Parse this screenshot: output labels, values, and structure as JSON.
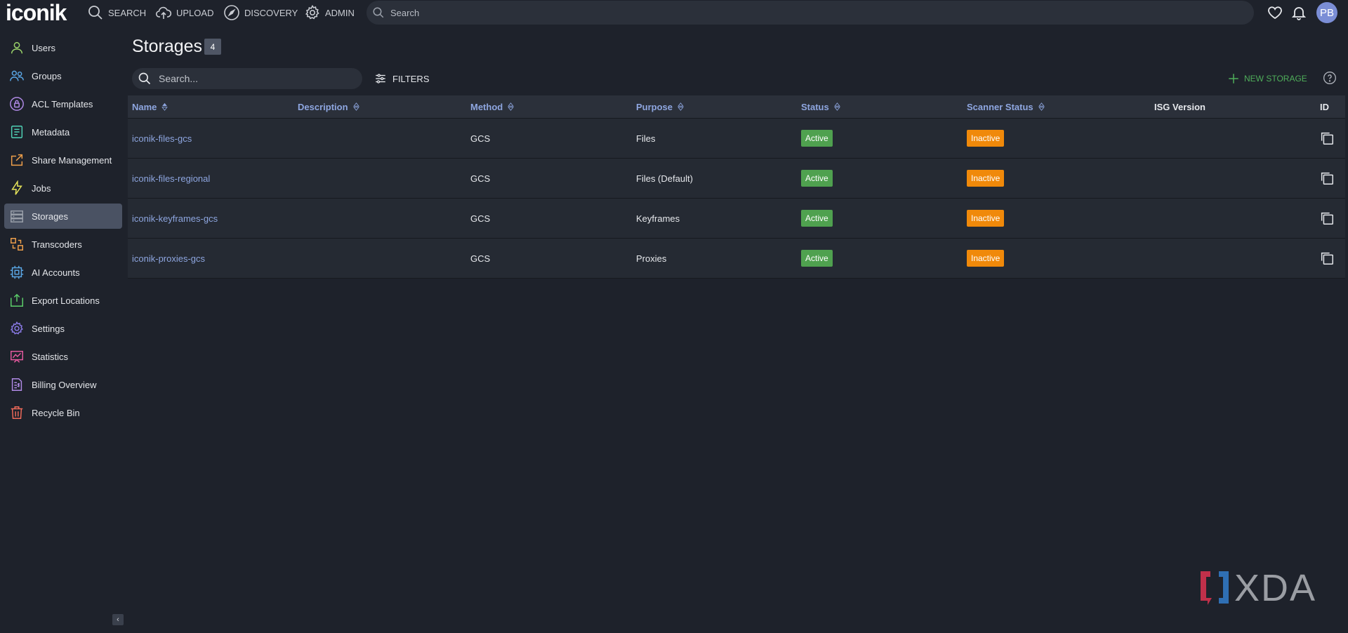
{
  "app": {
    "logo": "iconik"
  },
  "topnav": [
    {
      "label": "SEARCH",
      "icon": "search-icon"
    },
    {
      "label": "UPLOAD",
      "icon": "cloud-upload-icon"
    },
    {
      "label": "DISCOVERY",
      "icon": "compass-icon"
    },
    {
      "label": "ADMIN",
      "icon": "gear-icon"
    }
  ],
  "global_search": {
    "placeholder": "Search"
  },
  "user": {
    "initials": "PB"
  },
  "sidebar": {
    "items": [
      {
        "label": "Users",
        "icon": "user-icon",
        "color": "#9bd46a"
      },
      {
        "label": "Groups",
        "icon": "users-icon",
        "color": "#5aa7e6"
      },
      {
        "label": "ACL Templates",
        "icon": "lock-icon",
        "color": "#b08ae6"
      },
      {
        "label": "Metadata",
        "icon": "document-icon",
        "color": "#4fd1b5"
      },
      {
        "label": "Share Management",
        "icon": "share-icon",
        "color": "#f0a04b"
      },
      {
        "label": "Jobs",
        "icon": "lightning-icon",
        "color": "#e6e45a"
      },
      {
        "label": "Storages",
        "icon": "storage-icon",
        "color": "#8c93a0"
      },
      {
        "label": "Transcoders",
        "icon": "transcoder-icon",
        "color": "#f0a04b"
      },
      {
        "label": "AI Accounts",
        "icon": "chip-icon",
        "color": "#5aa7e6"
      },
      {
        "label": "Export Locations",
        "icon": "export-icon",
        "color": "#5ccf6a"
      },
      {
        "label": "Settings",
        "icon": "gear-icon",
        "color": "#8a7ae6"
      },
      {
        "label": "Statistics",
        "icon": "chart-icon",
        "color": "#e65aa0"
      },
      {
        "label": "Billing Overview",
        "icon": "billing-icon",
        "color": "#b08ae6"
      },
      {
        "label": "Recycle Bin",
        "icon": "trash-icon",
        "color": "#f06a5a"
      }
    ],
    "active": "Storages",
    "collapse_label": "‹"
  },
  "page": {
    "title": "Storages",
    "count": "4",
    "search_placeholder": "Search...",
    "filters_label": "FILTERS",
    "new_label": "NEW STORAGE"
  },
  "table": {
    "columns": [
      "Name",
      "Description",
      "Method",
      "Purpose",
      "Status",
      "Scanner Status",
      "ISG Version",
      "ID"
    ],
    "rows": [
      {
        "name": "iconik-files-gcs",
        "description": "",
        "method": "GCS",
        "purpose": "Files",
        "status": "Active",
        "scanner": "Inactive",
        "isg": ""
      },
      {
        "name": "iconik-files-regional",
        "description": "",
        "method": "GCS",
        "purpose": "Files (Default)",
        "status": "Active",
        "scanner": "Inactive",
        "isg": ""
      },
      {
        "name": "iconik-keyframes-gcs",
        "description": "",
        "method": "GCS",
        "purpose": "Keyframes",
        "status": "Active",
        "scanner": "Inactive",
        "isg": ""
      },
      {
        "name": "iconik-proxies-gcs",
        "description": "",
        "method": "GCS",
        "purpose": "Proxies",
        "status": "Active",
        "scanner": "Inactive",
        "isg": ""
      }
    ]
  },
  "watermark": {
    "text": "XDA"
  },
  "colors": {
    "accent_link": "#8ea6e0",
    "active_green": "#4fa14f",
    "inactive_orange": "#f0890a",
    "new_green": "#4fae5a"
  }
}
